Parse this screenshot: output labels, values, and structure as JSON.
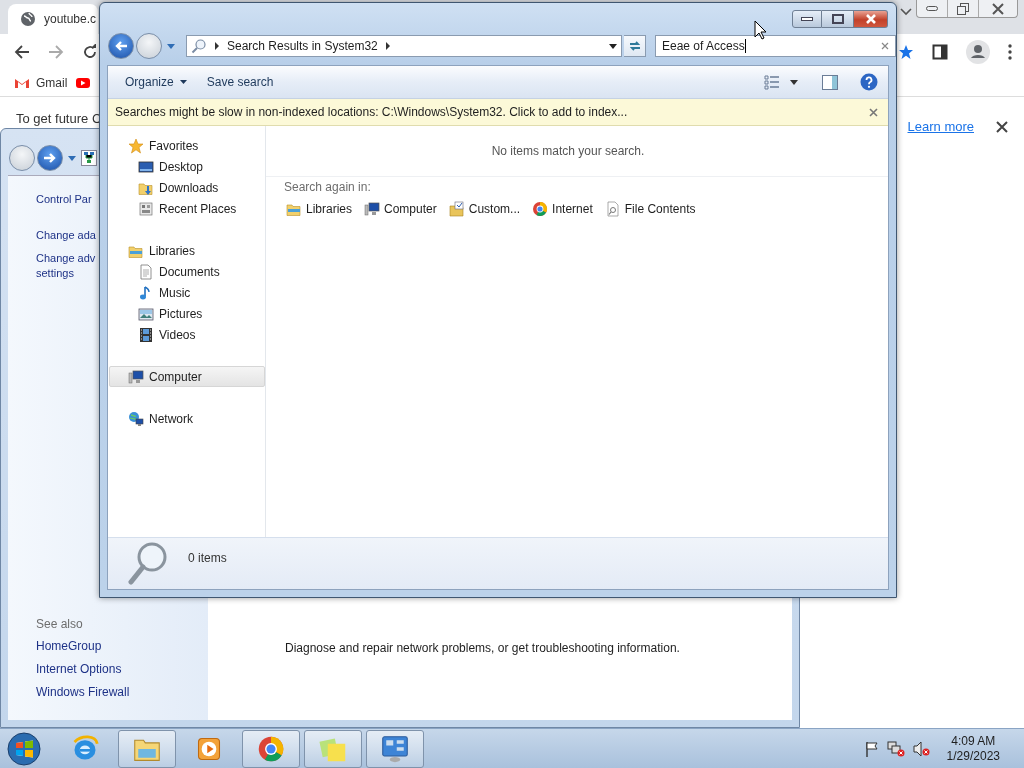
{
  "browser": {
    "tab": {
      "title": "youtube.c"
    },
    "bookmarks": [
      {
        "label": "Gmail",
        "kind": "gmail"
      },
      {
        "kind": "youtube"
      }
    ],
    "infobar": {
      "text": "To get future C",
      "link": "Learn more"
    }
  },
  "control_panel": {
    "tasks": [
      {
        "lines": [
          "Control Par"
        ]
      },
      {
        "lines": [
          "Change ada"
        ]
      },
      {
        "lines": [
          "Change adv",
          "settings"
        ]
      }
    ],
    "see_also": {
      "heading": "See also",
      "links": [
        "HomeGroup",
        "Internet Options",
        "Windows Firewall"
      ]
    },
    "content_text": "Diagnose and repair network problems, or get troubleshooting information."
  },
  "explorer": {
    "address": {
      "crumbs": [
        "Search Results in System32"
      ]
    },
    "search": {
      "value": "Eeae of Access"
    },
    "toolbar": [
      {
        "label": "Organize",
        "dropdown": true
      },
      {
        "label": "Save search",
        "dropdown": false
      }
    ],
    "infobar": "Searches might be slow in non-indexed locations: C:\\Windows\\System32. Click to add to index...",
    "nav_pane": [
      {
        "label": "Favorites",
        "kind": "favorites",
        "selected": false,
        "children": [
          {
            "label": "Desktop",
            "kind": "desktop",
            "selected": false
          },
          {
            "label": "Downloads",
            "kind": "downloads",
            "selected": false
          },
          {
            "label": "Recent Places",
            "kind": "recent",
            "selected": false
          }
        ]
      },
      {
        "label": "Libraries",
        "kind": "libraries",
        "selected": false,
        "children": [
          {
            "label": "Documents",
            "kind": "documents",
            "selected": false
          },
          {
            "label": "Music",
            "kind": "music",
            "selected": false
          },
          {
            "label": "Pictures",
            "kind": "pictures",
            "selected": false
          },
          {
            "label": "Videos",
            "kind": "videos",
            "selected": false
          }
        ]
      },
      {
        "label": "Computer",
        "kind": "computer",
        "selected": true
      },
      {
        "label": "Network",
        "kind": "network",
        "selected": false
      }
    ],
    "empty_message": "No items match your search.",
    "search_again": {
      "label": "Search again in:",
      "locations": [
        {
          "label": "Libraries",
          "kind": "libraries"
        },
        {
          "label": "Computer",
          "kind": "computer"
        },
        {
          "label": "Custom...",
          "kind": "custom"
        },
        {
          "label": "Internet",
          "kind": "chrome"
        },
        {
          "label": "File Contents",
          "kind": "file-contents"
        }
      ]
    },
    "status": "0 items"
  },
  "taskbar": {
    "apps": [
      {
        "kind": "ie",
        "open": false
      },
      {
        "kind": "explorer",
        "open": true
      },
      {
        "kind": "media-player",
        "open": false
      },
      {
        "kind": "chrome",
        "open": true
      },
      {
        "kind": "sticky-notes",
        "open": true
      },
      {
        "kind": "control-panel",
        "open": true
      }
    ],
    "clock": {
      "time": "4:09 AM",
      "date": "1/29/2023"
    }
  }
}
